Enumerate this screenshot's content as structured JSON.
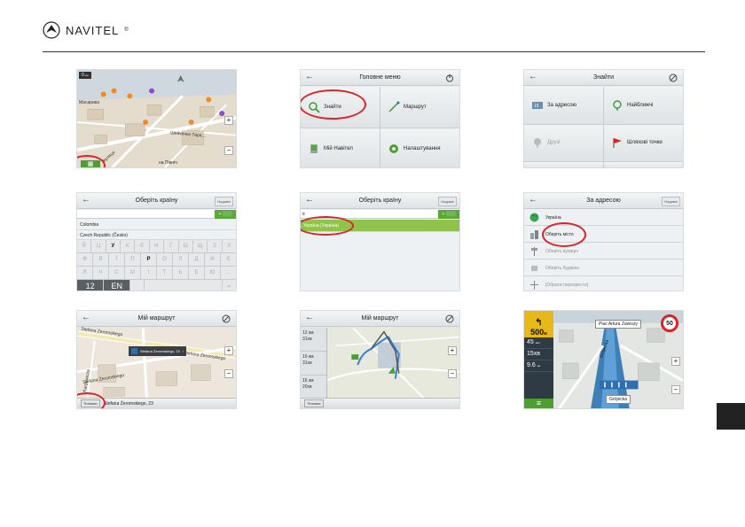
{
  "brand": {
    "name": "NAVITEL",
    "reg": "®"
  },
  "colors": {
    "accent_green": "#5aa83a",
    "highlight_red": "#d8262d",
    "selected_row": "#8fc34b",
    "nav_yellow": "#e8b81a"
  },
  "shot1": {
    "distance": "0",
    "distance_unit": "км",
    "streets": [
      "Шевченка Тара…",
      "на Північ",
      "Масарика",
      "вулиця"
    ],
    "menu_icon": "grid-menu-icon"
  },
  "shot2": {
    "title": "Головне меню",
    "items": [
      "Знайти",
      "Маршрут",
      "Мій Навітел",
      "Налаштування"
    ]
  },
  "shot3": {
    "title": "Знайти",
    "items": [
      "За адресою",
      "Найближчі",
      "Друзі",
      "Шляхові точки"
    ]
  },
  "shot4": {
    "title": "Оберіть країну",
    "corner": "Недавні",
    "search_btn": "+ ░░░",
    "items": [
      "Colombia",
      "Czech Republic (Česko)"
    ],
    "keys_row1": [
      "Й",
      "Ц",
      "У",
      "К",
      "Е",
      "Н",
      "Г",
      "Ш",
      "Щ",
      "З",
      "Х"
    ],
    "keys_row2": [
      "Ф",
      "В",
      "Ї",
      "П",
      "Р",
      "О",
      "Л",
      "Д",
      "Ж",
      "Є"
    ],
    "keys_row3": [
      "Я",
      "Ч",
      "С",
      "М",
      "І",
      "Т",
      "Ь",
      "Б",
      "Ю",
      "←"
    ],
    "key_num": "12",
    "key_lang": "EN",
    "active_keys": [
      "У",
      "Р"
    ]
  },
  "shot5": {
    "title": "Оберіть країну",
    "corner": "Недавні",
    "query": "ё",
    "search_btn": "+ ░░░",
    "result": "Україна (Україна)"
  },
  "shot6": {
    "title": "За адресою",
    "corner": "Недавні",
    "items": [
      "Україна",
      "Оберіть місто",
      "Оберіть вулицю",
      "Оберіть будівлю",
      "[Обрати перехрестя]"
    ]
  },
  "shot7": {
    "title": "Мій маршрут",
    "streets": [
      "Stefana Żeromskiego",
      "Stefana Żeromskiego",
      "Karpowicza",
      "Stefana Żeromskiego"
    ],
    "popup": "Stefana Żeromskiego, 23",
    "bottom_btn": "Поїхали",
    "bottom_text": "Stefana Żeromskiego, 23"
  },
  "shot8": {
    "title": "Мій маршрут",
    "routes": [
      {
        "dist": "12",
        "dist_unit": "км",
        "time": "31хв"
      },
      {
        "dist": "10",
        "dist_unit": "км",
        "time": "31хв"
      },
      {
        "dist": "16",
        "dist_unit": "км",
        "time": "20хв"
      }
    ],
    "bottom_btn": "Поїхали"
  },
  "shot9": {
    "turn_dist": "500",
    "turn_unit": "м",
    "row1": "45",
    "row1_unit": "км/г",
    "row2": "15хв",
    "row3": "9.6",
    "row3_unit": "км",
    "street_top": "Plac Artura Zawiszy",
    "street_side": "Grójecka",
    "street_bottom": "Grójecka",
    "speed_limit": "50"
  }
}
